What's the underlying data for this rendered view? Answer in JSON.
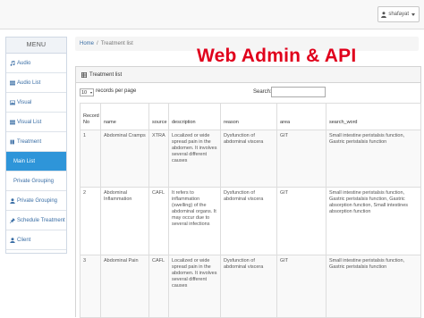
{
  "topbar": {
    "user_label": "shafayat"
  },
  "sidebar": {
    "title": "MENU",
    "items": [
      {
        "label": "Audio",
        "icon": "music-icon"
      },
      {
        "label": "Audio List",
        "icon": "list-icon"
      },
      {
        "label": "Visual",
        "icon": "image-icon"
      },
      {
        "label": "Visual List",
        "icon": "list-icon"
      },
      {
        "label": "Treatment",
        "icon": "treatment-icon"
      },
      {
        "label": "Main List",
        "icon": ""
      },
      {
        "label": "Private Grouping",
        "icon": ""
      },
      {
        "label": "Private Grouping",
        "icon": "user-icon"
      },
      {
        "label": "Schedule Treatment",
        "icon": "pin-icon"
      },
      {
        "label": "Client",
        "icon": "user-icon"
      }
    ]
  },
  "breadcrumb": {
    "home": "Home",
    "separator": "/",
    "current": "Treatment list"
  },
  "overlay": {
    "title": "Web Admin & API",
    "color": "#e0001c"
  },
  "panel": {
    "title": "Treatment list",
    "length_value": "10",
    "length_label": "records per page",
    "search_label": "Search:",
    "search_value": ""
  },
  "table": {
    "columns": [
      "Record No",
      "name",
      "source",
      "description",
      "reason",
      "area",
      "search_word"
    ],
    "rows": [
      {
        "record": "1",
        "name": "Abdominal Cramps",
        "source": "XTRA",
        "description": "Localized or wide spread pain in the abdomen. It involves several different causes",
        "reason": "Dysfunction of abdominal viscera",
        "area": "GIT",
        "search_word": "Small intestine peristalsis function, Gastric peristalsis function"
      },
      {
        "record": "2",
        "name": "Abdominal Inflammation",
        "source": "CAFL",
        "description": "It refers to inflammation (swelling) of the abdominal organs. It may occur due to several infections",
        "reason": "Dysfunction of abdominal viscera",
        "area": "GIT",
        "search_word": "Small intestine peristalsis function, Gastric peristalsis function, Gastric absorption function, Small intestines absorption function"
      },
      {
        "record": "3",
        "name": "Abdominal Pain",
        "source": "CAFL",
        "description": "Localized or wide spread pain in the abdomen. It involves several different causes",
        "reason": "Dysfunction of abdominal viscera",
        "area": "GIT",
        "search_word": "Small intestine peristalsis function, Gastric peristalsis function"
      }
    ]
  }
}
